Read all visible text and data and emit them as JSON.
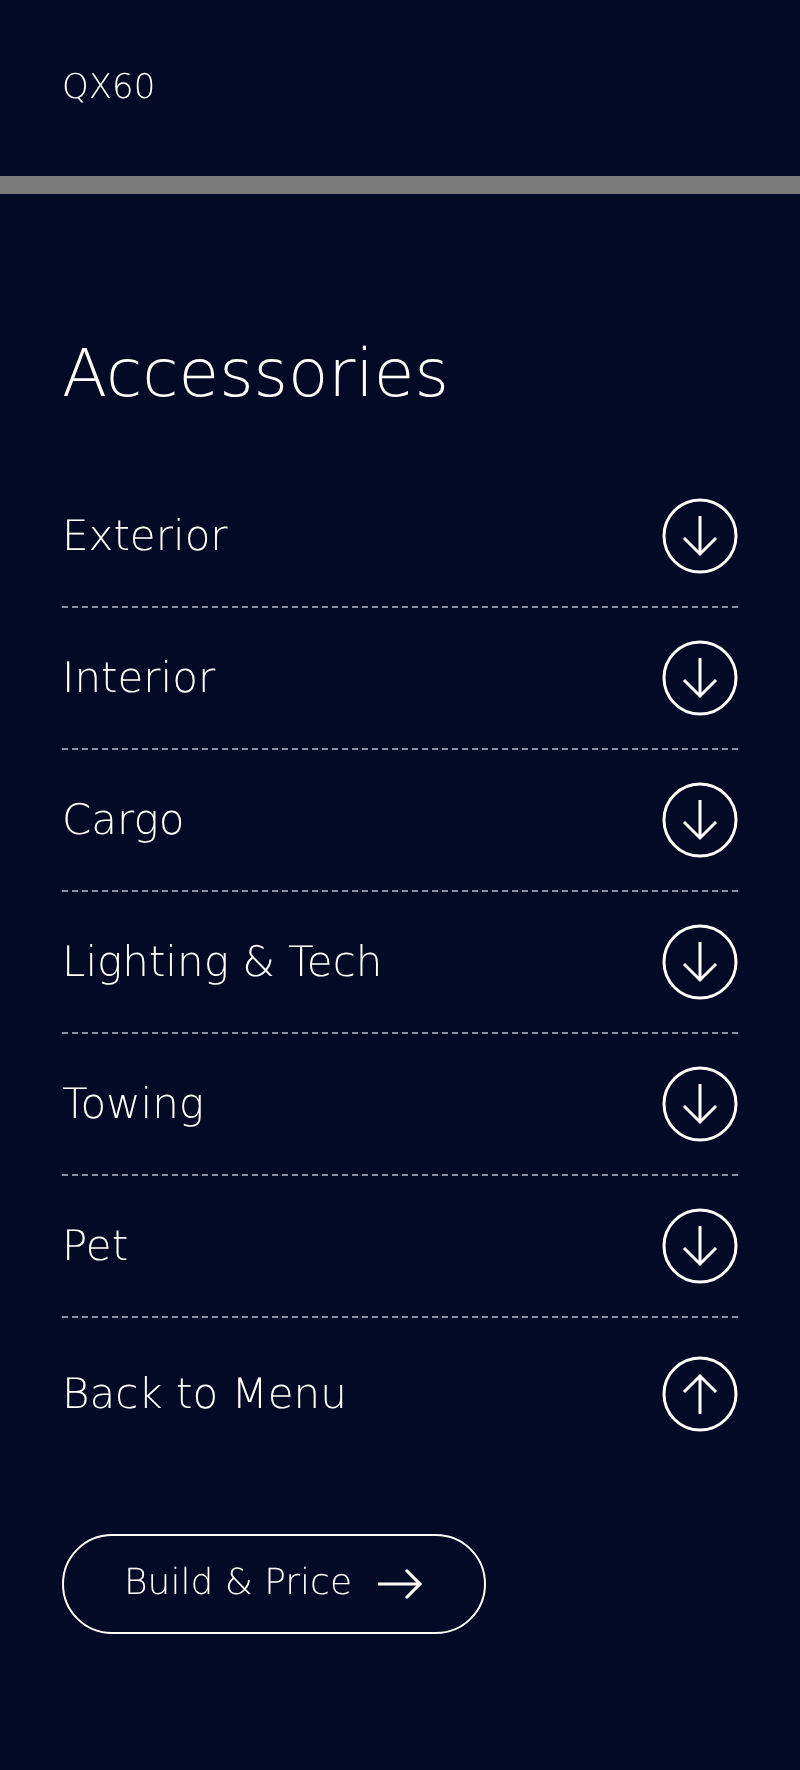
{
  "header": {
    "model": "QX60"
  },
  "title": "Accessories",
  "items": [
    {
      "label": "Exterior",
      "kind": "expand"
    },
    {
      "label": "Interior",
      "kind": "expand"
    },
    {
      "label": "Cargo",
      "kind": "expand"
    },
    {
      "label": "Lighting & Tech",
      "kind": "expand"
    },
    {
      "label": "Towing",
      "kind": "expand"
    },
    {
      "label": "Pet",
      "kind": "expand"
    },
    {
      "label": "Back to Menu",
      "kind": "back"
    }
  ],
  "cta": {
    "label": "Build & Price"
  }
}
